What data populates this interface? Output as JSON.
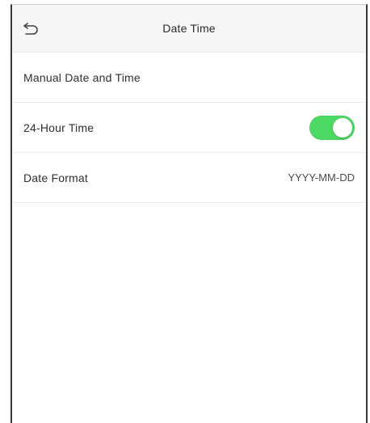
{
  "header": {
    "title": "Date Time",
    "back_icon": "back-arrow-icon"
  },
  "settings": [
    {
      "label": "Manual Date and Time"
    },
    {
      "label": "24-Hour Time",
      "toggle_on": true
    },
    {
      "label": "Date Format",
      "value": "YYYY-MM-DD"
    }
  ],
  "colors": {
    "toggle_on": "#4cd964",
    "header_bg": "#f7f7f7",
    "divider": "#ececec"
  }
}
